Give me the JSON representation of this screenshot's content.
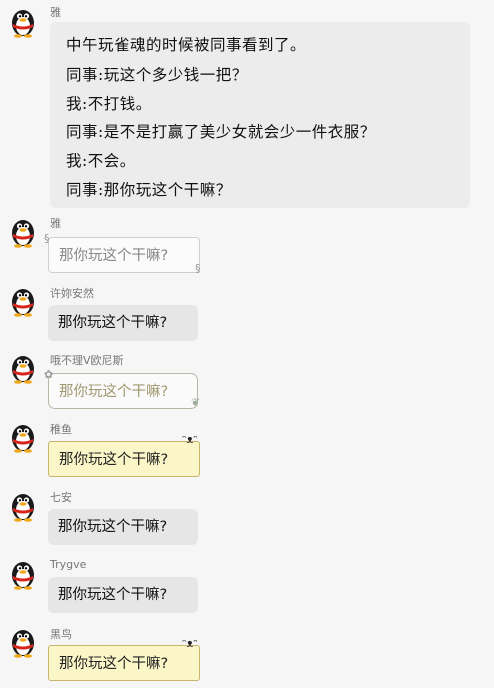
{
  "messages": [
    {
      "sender": "雅",
      "lines": [
        "中午玩雀魂的时候被同事看到了。",
        "同事:玩这个多少钱一把？",
        "我:不打钱。",
        "同事:是不是打赢了美少女就会少一件衣服？",
        "我:不会。",
        "同事:那你玩这个干嘛？"
      ]
    },
    {
      "sender": "雅",
      "text": "那你玩这个干嘛?",
      "style": "scroll"
    },
    {
      "sender": "许妳安然",
      "text": "那你玩这个干嘛?",
      "style": "gray"
    },
    {
      "sender": "哦不理V欧尼斯",
      "text": "那你玩这个干嘛?",
      "style": "outline"
    },
    {
      "sender": "稚鱼",
      "text": "那你玩这个干嘛?",
      "style": "yellow"
    },
    {
      "sender": "七安",
      "text": "那你玩这个干嘛?",
      "style": "gray"
    },
    {
      "sender": "Trygve",
      "text": "那你玩这个干嘛?",
      "style": "gray"
    },
    {
      "sender": "黑鸟",
      "text": "那你玩这个干嘛?",
      "style": "yellow"
    }
  ],
  "colors": {
    "background": "#f6f6f6",
    "bubble_gray": "#e6e6e6",
    "bubble_yellow": "#fbf6c8",
    "sender_text": "#777777"
  },
  "icons": {
    "avatar": "qq-penguin-icon"
  }
}
